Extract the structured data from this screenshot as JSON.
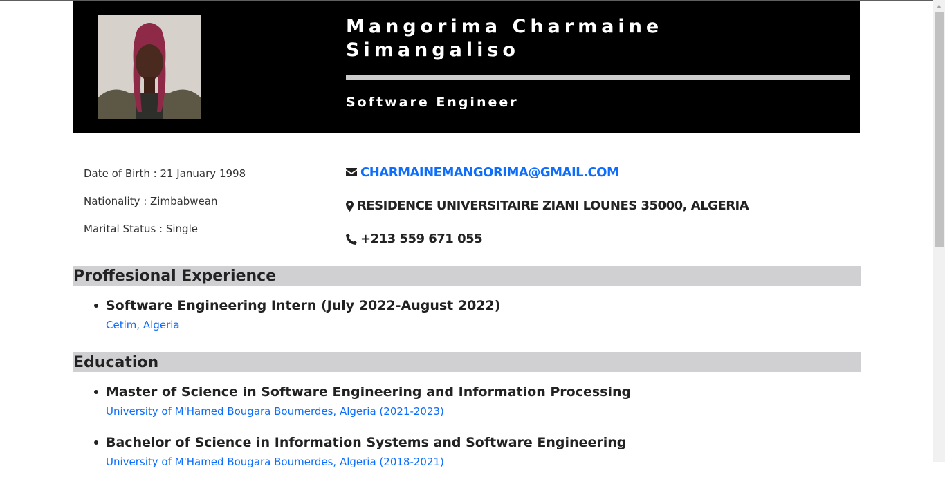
{
  "header": {
    "name": "Mangorima Charmaine Simangaliso",
    "role": "Software Engineer"
  },
  "personal": {
    "dob": "Date of Birth : 21 January 1998",
    "nationality": "Nationality : Zimbabwean",
    "marital": "Marital Status : Single"
  },
  "contact": {
    "email": "CHARMAINEMANGORIMA@GMAIL.COM",
    "address": "RESIDENCE UNIVERSITAIRE ZIANI LOUNES 35000, ALGERIA",
    "phone": "+213 559 671 055"
  },
  "experience": {
    "heading": "Proffesional Experience",
    "items": [
      {
        "title": "Software Engineering Intern (July 2022-August 2022)",
        "sub": "Cetim, Algeria"
      }
    ]
  },
  "education": {
    "heading": "Education",
    "items": [
      {
        "title": "Master of Science in Software Engineering and Information Processing",
        "sub": "University of M'Hamed Bougara Boumerdes, Algeria (2021-2023)"
      },
      {
        "title": "Bachelor of Science in Information Systems and Software Engineering",
        "sub": "University of M'Hamed Bougara Boumerdes, Algeria (2018-2021)"
      }
    ]
  },
  "colors": {
    "header_bg": "#000000",
    "section_bg": "#d0d0d2",
    "link": "#0d6efd"
  },
  "icons": [
    "envelope-icon",
    "map-marker-icon",
    "phone-icon"
  ]
}
